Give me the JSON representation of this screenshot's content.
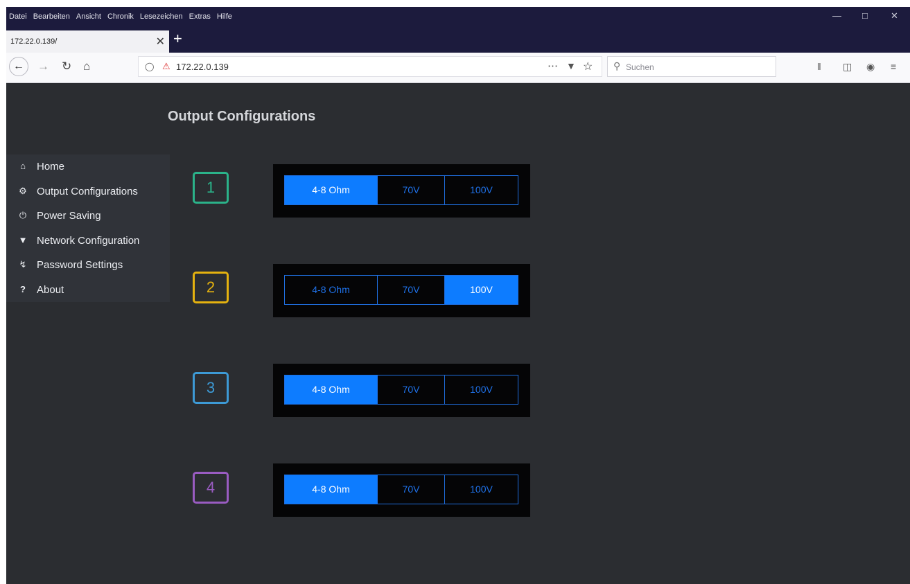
{
  "menubar": {
    "items": [
      "Datei",
      "Bearbeiten",
      "Ansicht",
      "Chronik",
      "Lesezeichen",
      "Extras",
      "Hilfe"
    ]
  },
  "tab": {
    "title": "172.22.0.139/"
  },
  "navbar": {
    "url": "172.22.0.139",
    "search_placeholder": "Suchen"
  },
  "page": {
    "title": "Output Configurations",
    "sidebar": [
      {
        "label": "Home",
        "icon": "home-icon"
      },
      {
        "label": "Output Configurations",
        "icon": "gear-icon"
      },
      {
        "label": "Power Saving",
        "icon": "power-icon"
      },
      {
        "label": "Network Configuration",
        "icon": "wifi-icon"
      },
      {
        "label": "Password Settings",
        "icon": "key-icon"
      },
      {
        "label": "About",
        "icon": "question-icon"
      }
    ],
    "outputs": [
      {
        "number": "1",
        "color": "#2bb38a",
        "options": [
          "4-8 Ohm",
          "70V",
          "100V"
        ],
        "selected": "4-8 Ohm"
      },
      {
        "number": "2",
        "color": "#e5b20f",
        "options": [
          "4-8 Ohm",
          "70V",
          "100V"
        ],
        "selected": "100V"
      },
      {
        "number": "3",
        "color": "#3d9ad6",
        "options": [
          "4-8 Ohm",
          "70V",
          "100V"
        ],
        "selected": "4-8 Ohm"
      },
      {
        "number": "4",
        "color": "#9a5cc2",
        "options": [
          "4-8 Ohm",
          "70V",
          "100V"
        ],
        "selected": "4-8 Ohm"
      }
    ]
  }
}
